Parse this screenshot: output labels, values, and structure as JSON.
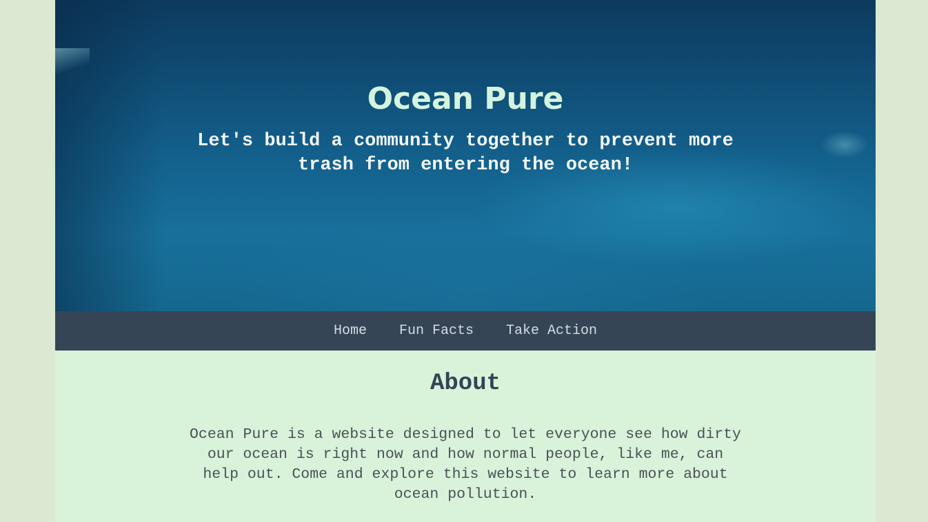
{
  "hero": {
    "title": "Ocean Pure",
    "tagline": "Let's build a community together to prevent more trash from entering the ocean!"
  },
  "nav": {
    "items": [
      {
        "label": "Home"
      },
      {
        "label": "Fun Facts"
      },
      {
        "label": "Take Action"
      }
    ]
  },
  "about": {
    "heading": "About",
    "body": "Ocean Pure is a website designed to let everyone see how dirty our ocean is right now and how normal people, like me, can help out. Come and explore this website to learn more about ocean pollution."
  },
  "colors": {
    "page_background": "#dbe9d3",
    "content_background": "#d9f3da",
    "hero_ocean": "#13608c",
    "nav_background": "#364556",
    "title_color": "#d4f5dd",
    "heading_color": "#2f4656"
  }
}
